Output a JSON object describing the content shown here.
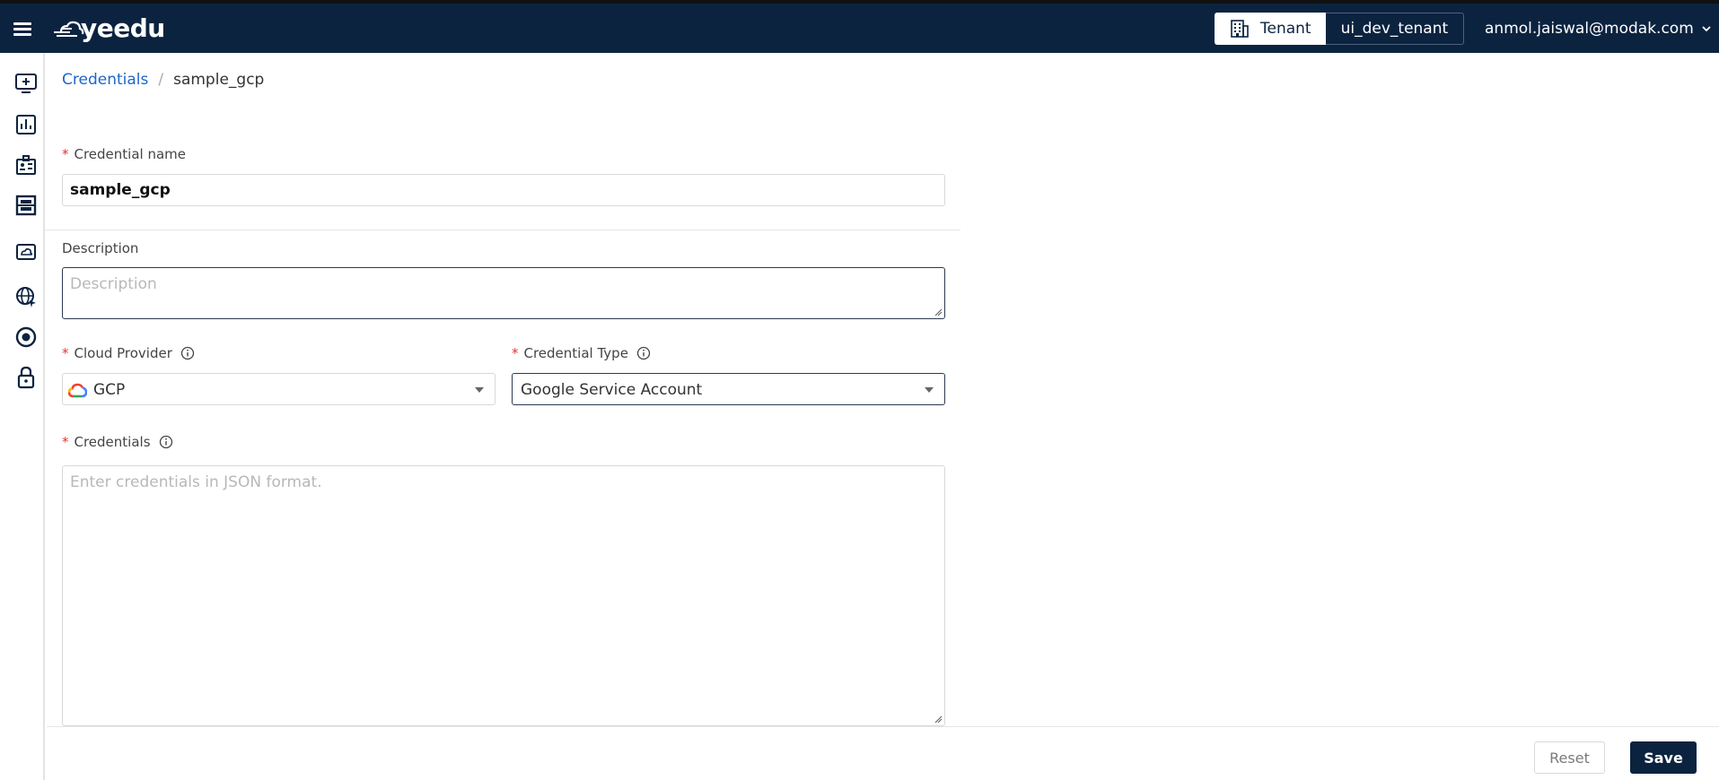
{
  "app": {
    "logo_text": "yeedu"
  },
  "header": {
    "tenant_label": "Tenant",
    "tenant_value": "ui_dev_tenant",
    "user_email": "anmol.jaiswal@modak.com"
  },
  "colors": {
    "topbar": "#0c2340",
    "link": "#1e66c9",
    "required": "#e0342f"
  },
  "sidebar": {
    "icons": [
      "create-workspace-icon",
      "dashboard-chart-icon",
      "clusters-icon",
      "storage-icon",
      "cloud-environment-icon",
      "network-icon",
      "target-icon",
      "lock-icon"
    ]
  },
  "breadcrumb": {
    "parent": "Credentials",
    "separator": "/",
    "current": "sample_gcp"
  },
  "form": {
    "credential_name": {
      "label": "Credential name",
      "value": "sample_gcp"
    },
    "description": {
      "label": "Description",
      "placeholder": "Description"
    },
    "cloud_provider": {
      "label": "Cloud Provider",
      "value": "GCP"
    },
    "credential_type": {
      "label": "Credential Type",
      "value": "Google Service Account"
    },
    "credentials": {
      "label": "Credentials",
      "placeholder": "Enter credentials in JSON format."
    }
  },
  "footer": {
    "reset_label": "Reset",
    "save_label": "Save"
  }
}
